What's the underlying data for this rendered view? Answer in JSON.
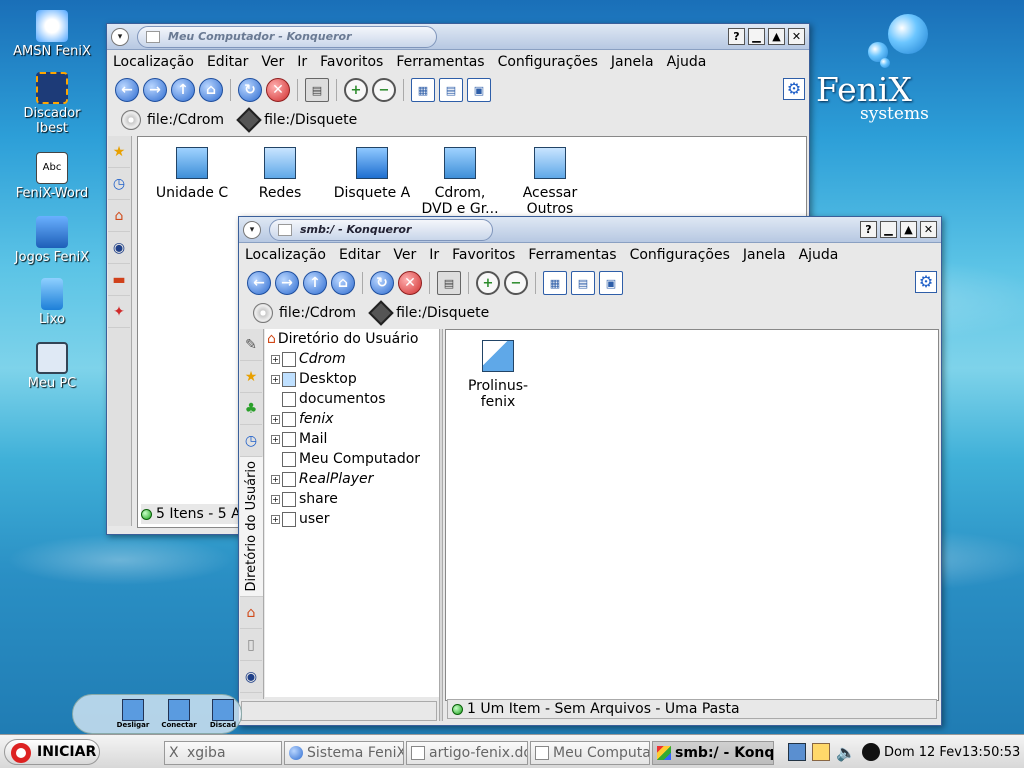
{
  "desktop": {
    "icons": [
      {
        "label": "AMSN FeniX",
        "icon": "amsn-icon"
      },
      {
        "label": "Discador\nIbest",
        "icon": "dialer-icon"
      },
      {
        "label": "FeniX-Word",
        "icon": "word-icon"
      },
      {
        "label": "Jogos FeniX",
        "icon": "games-icon"
      },
      {
        "label": "Lixo",
        "icon": "trash-icon"
      },
      {
        "label": "Meu PC",
        "icon": "computer-icon"
      }
    ],
    "logo": {
      "name": "FeniX",
      "sub": "systems"
    },
    "quick_launch": [
      {
        "label": "Desligar"
      },
      {
        "label": "Conectar"
      },
      {
        "label": "Discad"
      }
    ]
  },
  "window_back": {
    "title": "Meu Computador - Konqueror",
    "menu": [
      "Localização",
      "Editar",
      "Ver",
      "Ir",
      "Favoritos",
      "Ferramentas",
      "Configurações",
      "Janela",
      "Ajuda"
    ],
    "location": {
      "cd": "file:/Cdrom",
      "floppy": "file:/Disquete"
    },
    "items": [
      {
        "label": "Unidade C"
      },
      {
        "label": "Redes"
      },
      {
        "label": "Disquete A"
      },
      {
        "label": "Cdrom,\nDVD e Gr..."
      },
      {
        "label": "Acessar\nOutros"
      }
    ],
    "status": "5 Itens - 5 A"
  },
  "window_front": {
    "title": "smb:/ - Konqueror",
    "menu": [
      "Localização",
      "Editar",
      "Ver",
      "Ir",
      "Favoritos",
      "Ferramentas",
      "Configurações",
      "Janela",
      "Ajuda"
    ],
    "location": {
      "cd": "file:/Cdrom",
      "floppy": "file:/Disquete"
    },
    "tree_root": "Diretório do Usuário",
    "tree": [
      {
        "label": "Cdrom",
        "italic": true,
        "expand": true
      },
      {
        "label": "Desktop",
        "italic": false,
        "expand": true
      },
      {
        "label": "documentos",
        "italic": false,
        "expand": false
      },
      {
        "label": "fenix",
        "italic": true,
        "expand": true
      },
      {
        "label": "Mail",
        "italic": false,
        "expand": true
      },
      {
        "label": "Meu Computador",
        "italic": false,
        "expand": false
      },
      {
        "label": "RealPlayer",
        "italic": true,
        "expand": true
      },
      {
        "label": "share",
        "italic": false,
        "expand": true
      },
      {
        "label": "user",
        "italic": false,
        "expand": true
      }
    ],
    "side_tab_label": "Diretório do Usuário",
    "items": [
      {
        "label": "Prolinus-\nfenix"
      }
    ],
    "status": "1 Um Item - Sem Arquivos - Uma Pasta"
  },
  "taskbar": {
    "start": "INICIAR",
    "tasks": [
      {
        "label": "xgiba"
      },
      {
        "label": "Sistema FeniX"
      },
      {
        "label": "artigo-fenix.do"
      },
      {
        "label": "Meu Computa"
      },
      {
        "label": "smb:/ - Konq"
      }
    ],
    "clock": "Dom 12 Fev13:50:53"
  }
}
